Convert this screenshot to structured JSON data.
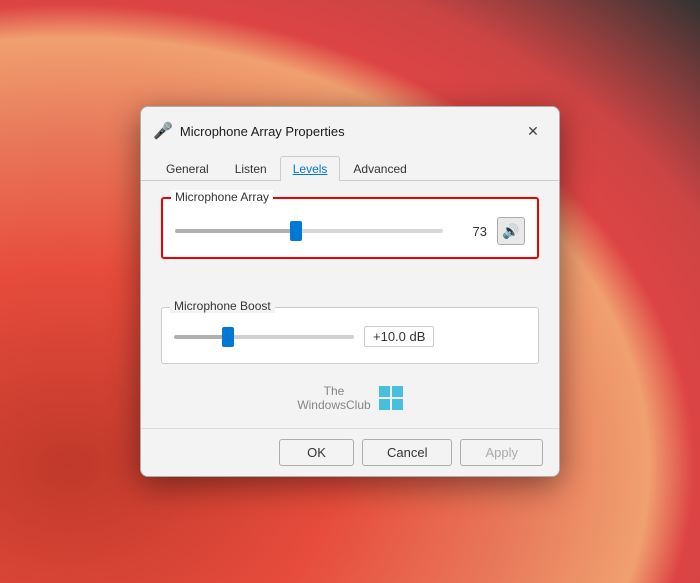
{
  "dialog": {
    "title": "Microphone Array Properties",
    "title_icon": "🎤",
    "close_label": "✕"
  },
  "tabs": [
    {
      "id": "general",
      "label": "General",
      "active": false,
      "highlighted": false
    },
    {
      "id": "listen",
      "label": "Listen",
      "active": false,
      "highlighted": false
    },
    {
      "id": "levels",
      "label": "Levels",
      "active": true,
      "highlighted": true
    },
    {
      "id": "advanced",
      "label": "Advanced",
      "active": false,
      "highlighted": false
    }
  ],
  "sections": {
    "microphone_array": {
      "label": "Microphone Array",
      "slider_value": "73",
      "slider_percent": 45,
      "volume_icon": "🔊"
    },
    "microphone_boost": {
      "label": "Microphone Boost",
      "slider_percent": 30,
      "boost_value": "+10.0 dB"
    }
  },
  "watermark": {
    "text_line1": "The",
    "text_line2": "WindowsClub"
  },
  "footer": {
    "ok_label": "OK",
    "cancel_label": "Cancel",
    "apply_label": "Apply"
  }
}
